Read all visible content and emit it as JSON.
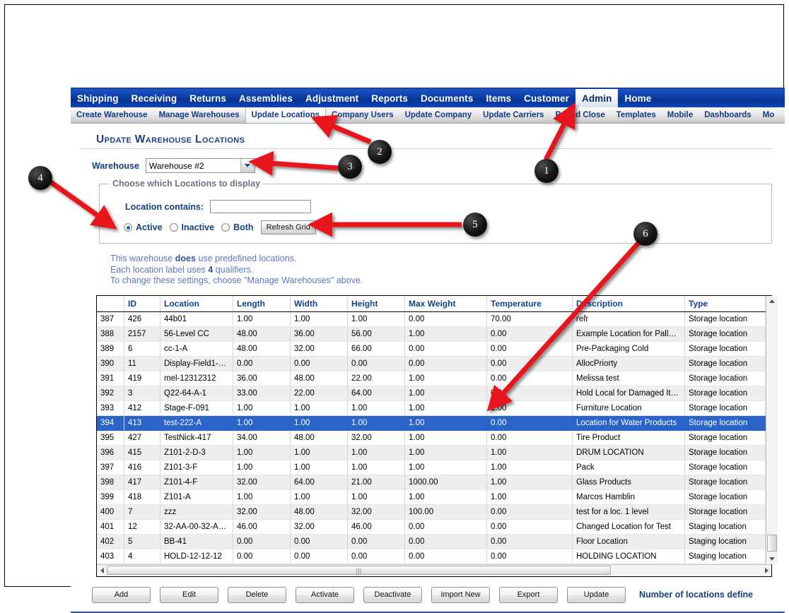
{
  "app": {
    "title": "Update Warehouse Locations"
  },
  "menu_top": {
    "items": [
      {
        "label": "Shipping",
        "active": false
      },
      {
        "label": "Receiving",
        "active": false
      },
      {
        "label": "Returns",
        "active": false
      },
      {
        "label": "Assemblies",
        "active": false
      },
      {
        "label": "Adjustment",
        "active": false
      },
      {
        "label": "Reports",
        "active": false
      },
      {
        "label": "Documents",
        "active": false
      },
      {
        "label": "Items",
        "active": false
      },
      {
        "label": "Customer",
        "active": false
      },
      {
        "label": "Admin",
        "active": true
      },
      {
        "label": "Home",
        "active": false
      }
    ]
  },
  "menu_sub": {
    "items": [
      {
        "label": "Create Warehouse",
        "active": false
      },
      {
        "label": "Manage Warehouses",
        "active": false
      },
      {
        "label": "Update Locations",
        "active": true
      },
      {
        "label": "Company Users",
        "active": false
      },
      {
        "label": "Update Company",
        "active": false
      },
      {
        "label": "Update Carriers",
        "active": false
      },
      {
        "label": "Period Close",
        "active": false
      },
      {
        "label": "Templates",
        "active": false
      },
      {
        "label": "Mobile",
        "active": false
      },
      {
        "label": "Dashboards",
        "active": false
      },
      {
        "label": "Mo",
        "active": false
      }
    ]
  },
  "warehouse": {
    "label": "Warehouse",
    "selected": "Warehouse #2"
  },
  "filter": {
    "legend": "Choose which Locations to display",
    "contains_label": "Location contains:",
    "contains_value": "",
    "contains_placeholder": "",
    "radio_active": "Active",
    "radio_inactive": "Inactive",
    "radio_both": "Both",
    "selected_radio": "Active",
    "refresh_label": "Refresh Grid"
  },
  "info": {
    "line1_a": "This warehouse ",
    "line1_b": "does",
    "line1_c": " use predefined locations.",
    "line2_a": "Each location label uses ",
    "line2_b": "4",
    "line2_c": " qualifiers.",
    "line3": "To change these settings, choose \"Manage Warehouses\" above."
  },
  "grid": {
    "columns": [
      "",
      "ID",
      "Location",
      "Length",
      "Width",
      "Height",
      "Max Weight",
      "Temperature",
      "Description",
      "Type"
    ],
    "selected_row_index": 7,
    "rows": [
      {
        "num": "387",
        "id": "426",
        "location": "44b01",
        "length": "1.00",
        "width": "1.00",
        "height": "1.00",
        "max_weight": "0.00",
        "temperature": "70.00",
        "description": "refr",
        "type": "Storage location"
      },
      {
        "num": "388",
        "id": "2157",
        "location": "56-Level CC",
        "length": "48.00",
        "width": "36.00",
        "height": "56.00",
        "max_weight": "1.00",
        "temperature": "0.00",
        "description": "Example Location for Pallet ...",
        "type": "Storage location"
      },
      {
        "num": "389",
        "id": "6",
        "location": "cc-1-A",
        "length": "48.00",
        "width": "32.00",
        "height": "66.00",
        "max_weight": "0.00",
        "temperature": "0.00",
        "description": "Pre-Packaging Cold",
        "type": "Storage location"
      },
      {
        "num": "390",
        "id": "11",
        "location": "Display-Field1-Fi…",
        "length": "0.00",
        "width": "0.00",
        "height": "0.00",
        "max_weight": "0.00",
        "temperature": "0.00",
        "description": "AllocPriorty",
        "type": "Storage location"
      },
      {
        "num": "391",
        "id": "419",
        "location": "mel-12312312",
        "length": "36.00",
        "width": "48.00",
        "height": "22.00",
        "max_weight": "1.00",
        "temperature": "0.00",
        "description": "Melissa test",
        "type": "Storage location"
      },
      {
        "num": "392",
        "id": "3",
        "location": "Q22-64-A-1",
        "length": "33.00",
        "width": "22.00",
        "height": "64.00",
        "max_weight": "1.00",
        "temperature": "0.00",
        "description": "Hold Local for Damaged Ite…",
        "type": "Storage location"
      },
      {
        "num": "393",
        "id": "412",
        "location": "Stage-F-091",
        "length": "1.00",
        "width": "1.00",
        "height": "1.00",
        "max_weight": "1.00",
        "temperature": "1.00",
        "description": "Furniture Location",
        "type": "Storage location"
      },
      {
        "num": "394",
        "id": "413",
        "location": "test-222-A",
        "length": "1.00",
        "width": "1.00",
        "height": "1.00",
        "max_weight": "1.00",
        "temperature": "0.00",
        "description": "Location for Water Products",
        "type": "Storage location"
      },
      {
        "num": "395",
        "id": "427",
        "location": "TestNick-417",
        "length": "34.00",
        "width": "48.00",
        "height": "32.00",
        "max_weight": "1.00",
        "temperature": "0.00",
        "description": "Tire Product",
        "type": "Storage location"
      },
      {
        "num": "396",
        "id": "415",
        "location": "Z101-2-D-3",
        "length": "1.00",
        "width": "1.00",
        "height": "1.00",
        "max_weight": "1.00",
        "temperature": "1.00",
        "description": "DRUM LOCATION",
        "type": "Storage location"
      },
      {
        "num": "397",
        "id": "416",
        "location": "Z101-3-F",
        "length": "1.00",
        "width": "1.00",
        "height": "1.00",
        "max_weight": "1.00",
        "temperature": "1.00",
        "description": "Pack",
        "type": "Storage location"
      },
      {
        "num": "398",
        "id": "417",
        "location": "Z101-4-F",
        "length": "32.00",
        "width": "64.00",
        "height": "21.00",
        "max_weight": "1000.00",
        "temperature": "1.00",
        "description": "Glass Products",
        "type": "Storage location"
      },
      {
        "num": "399",
        "id": "418",
        "location": "Z101-A",
        "length": "1.00",
        "width": "1.00",
        "height": "1.00",
        "max_weight": "1.00",
        "temperature": "1.00",
        "description": "Marcos Hamblin",
        "type": "Storage location"
      },
      {
        "num": "400",
        "id": "7",
        "location": "zzz",
        "length": "32.00",
        "width": "48.00",
        "height": "32.00",
        "max_weight": "100.00",
        "temperature": "0.00",
        "description": "test for a loc. 1 level",
        "type": "Storage location"
      },
      {
        "num": "401",
        "id": "12",
        "location": "32-AA-00-32-AA…",
        "length": "46.00",
        "width": "32.00",
        "height": "46.00",
        "max_weight": "0.00",
        "temperature": "0.00",
        "description": "Changed Location for Test",
        "type": "Staging location"
      },
      {
        "num": "402",
        "id": "5",
        "location": "BB-41",
        "length": "0.00",
        "width": "0.00",
        "height": "0.00",
        "max_weight": "0.00",
        "temperature": "0.00",
        "description": "Floor Location",
        "type": "Staging location"
      },
      {
        "num": "403",
        "id": "4",
        "location": "HOLD-12-12-12",
        "length": "0.00",
        "width": "0.00",
        "height": "0.00",
        "max_weight": "0.00",
        "temperature": "0.00",
        "description": "HOLDING LOCATION",
        "type": "Staging location"
      }
    ]
  },
  "actions": {
    "buttons": [
      "Add",
      "Edit",
      "Delete",
      "Activate",
      "Deactivate",
      "Import New",
      "Export",
      "Update"
    ],
    "count_text": "Number of locations define"
  },
  "callouts": [
    {
      "number": "1"
    },
    {
      "number": "2"
    },
    {
      "number": "3"
    },
    {
      "number": "4"
    },
    {
      "number": "5"
    },
    {
      "number": "6"
    }
  ],
  "colors": {
    "menu_blue": "#0b3da8",
    "link_blue": "#123a86",
    "selection_blue": "#2a64c8",
    "callout_red": "#e8151a",
    "info_text": "#5b77bd"
  }
}
